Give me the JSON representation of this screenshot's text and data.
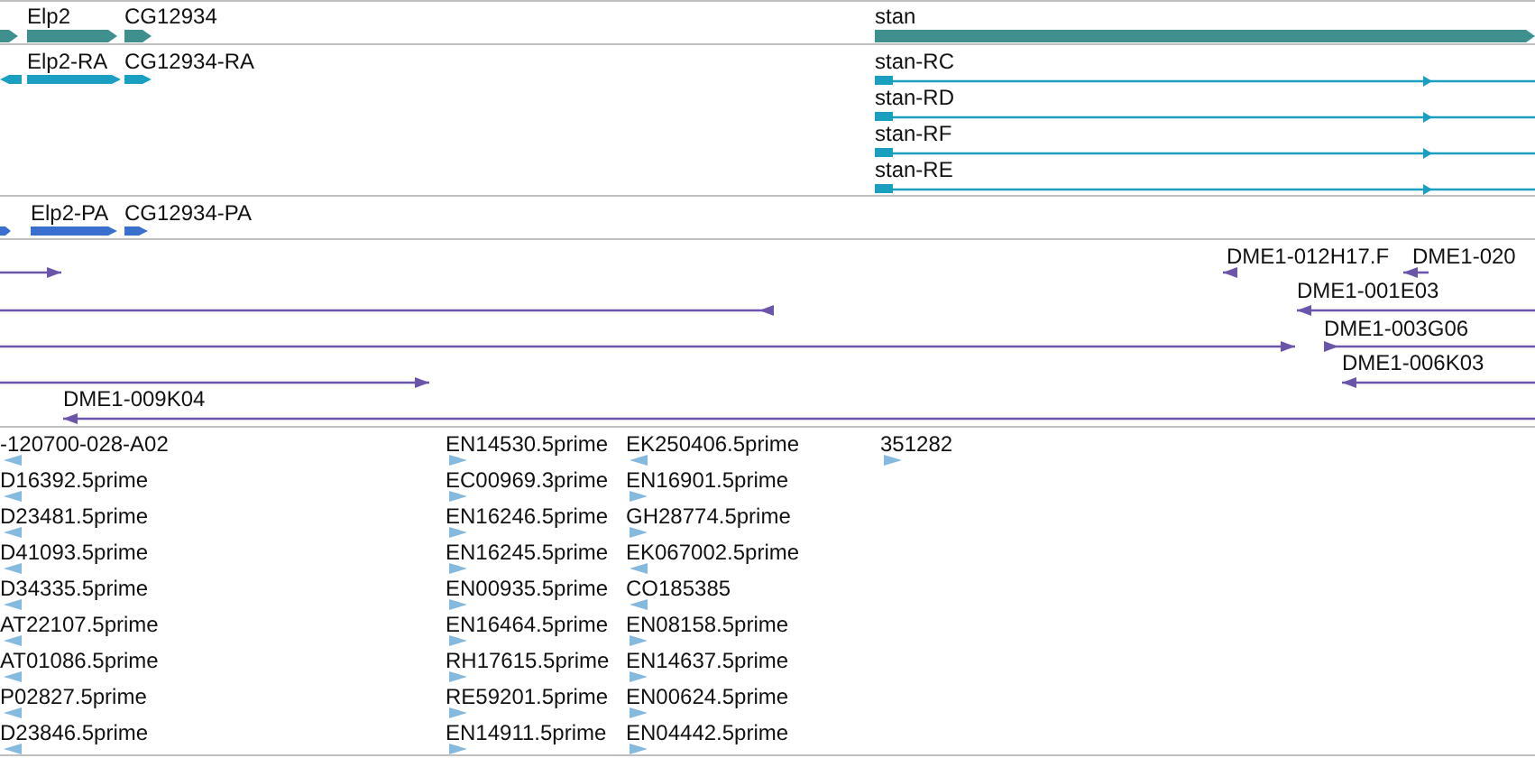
{
  "tracks": [
    {
      "kind": "gene",
      "features": [
        {
          "reverse": false
        },
        {
          "label": "Elp2",
          "reverse": false
        },
        {
          "label": "CG12934",
          "reverse": false
        },
        {
          "label": "stan",
          "reverse": false
        }
      ]
    },
    {
      "kind": "transcript",
      "features": [
        {
          "reverse": true
        },
        {
          "label": "Elp2-RA",
          "reverse": false
        },
        {
          "label": "CG12934-RA",
          "reverse": false
        },
        {
          "label": "stan-RC",
          "reverse": false
        },
        {
          "label": "stan-RD",
          "reverse": false
        },
        {
          "label": "stan-RF",
          "reverse": false
        },
        {
          "label": "stan-RE",
          "reverse": false
        }
      ]
    },
    {
      "kind": "protein",
      "features": [
        {
          "reverse": false
        },
        {
          "label": "Elp2-PA",
          "reverse": false
        },
        {
          "label": "CG12934-PA",
          "reverse": false
        }
      ]
    },
    {
      "kind": "clone",
      "features": [
        {
          "reverse": false
        },
        {
          "label": "DME1-012H17.F",
          "reverse": true
        },
        {
          "label": "DME1-020",
          "reverse": true
        },
        {
          "reverse": true
        },
        {
          "label": "DME1-001E03",
          "reverse": true
        },
        {
          "reverse": false
        },
        {
          "label": "DME1-003G06",
          "reverse": false
        },
        {
          "reverse": false
        },
        {
          "label": "DME1-006K03",
          "reverse": true
        },
        {
          "label": "DME1-009K04",
          "reverse": true
        }
      ]
    },
    {
      "kind": "est",
      "features": [
        {
          "label": "-120700-028-A02",
          "reverse": true
        },
        {
          "label": "D16392.5prime",
          "reverse": true
        },
        {
          "label": "D23481.5prime",
          "reverse": true
        },
        {
          "label": "D41093.5prime",
          "reverse": true
        },
        {
          "label": "D34335.5prime",
          "reverse": true
        },
        {
          "label": "AT22107.5prime",
          "reverse": true
        },
        {
          "label": "AT01086.5prime",
          "reverse": true
        },
        {
          "label": "P02827.5prime",
          "reverse": true
        },
        {
          "label": "D23846.5prime",
          "reverse": true
        },
        {
          "label": "EN14530.5prime",
          "reverse": false
        },
        {
          "label": "EC00969.3prime",
          "reverse": false
        },
        {
          "label": "EN16246.5prime",
          "reverse": false
        },
        {
          "label": "EN16245.5prime",
          "reverse": false
        },
        {
          "label": "EN00935.5prime",
          "reverse": false
        },
        {
          "label": "EN16464.5prime",
          "reverse": false
        },
        {
          "label": "RH17615.5prime",
          "reverse": false
        },
        {
          "label": "RE59201.5prime",
          "reverse": false
        },
        {
          "label": "EN14911.5prime",
          "reverse": false
        },
        {
          "label": "EK250406.5prime",
          "reverse": true
        },
        {
          "label": "EN16901.5prime",
          "reverse": false
        },
        {
          "label": "GH28774.5prime",
          "reverse": false
        },
        {
          "label": "EK067002.5prime",
          "reverse": true
        },
        {
          "label": "CO185385",
          "reverse": true
        },
        {
          "label": "EN08158.5prime",
          "reverse": false
        },
        {
          "label": "EN14637.5prime",
          "reverse": false
        },
        {
          "label": "EN00624.5prime",
          "reverse": false
        },
        {
          "label": "EN04442.5prime",
          "reverse": false
        },
        {
          "label": "351282",
          "reverse": false
        }
      ]
    }
  ]
}
